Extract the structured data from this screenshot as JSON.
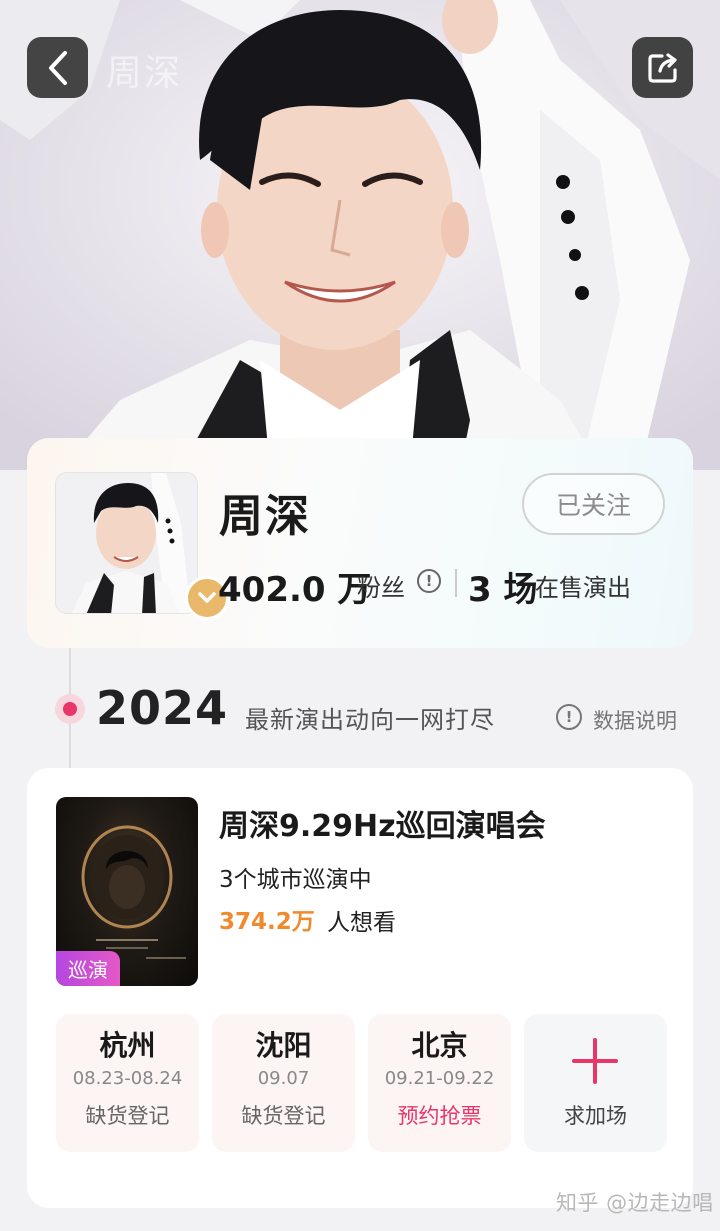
{
  "nav": {
    "title": "周深",
    "back_icon": "chevron-left-icon",
    "share_icon": "share-icon"
  },
  "artist": {
    "name": "周深",
    "follow_label": "已关注",
    "fans_count": "402.0 万",
    "fans_label": "粉丝",
    "info_glyph": "!",
    "shows_count": "3 场",
    "shows_label": "在售演出",
    "badge_icon": "verified-check-icon",
    "badge_color": "#e9b86a"
  },
  "timeline": {
    "year": "2024",
    "subtitle": "最新演出动向一网打尽",
    "data_info_glyph": "!",
    "data_info_label": "数据说明",
    "accent_color": "#e8366a"
  },
  "tour": {
    "tag": "巡演",
    "title": "周深9.29Hz巡回演唱会",
    "cities_text": "3个城市巡演中",
    "want_count": "374.2万",
    "want_label": "人想看",
    "cities": [
      {
        "name": "杭州",
        "date": "08.23-08.24",
        "status": "缺货登记"
      },
      {
        "name": "沈阳",
        "date": "09.07",
        "status": "缺货登记"
      },
      {
        "name": "北京",
        "date": "09.21-09.22",
        "status": "预约抢票"
      }
    ],
    "add_label": "求加场",
    "add_icon": "plus-icon",
    "want_color": "#f08a2c"
  },
  "watermark": "知乎 @边走边唱"
}
